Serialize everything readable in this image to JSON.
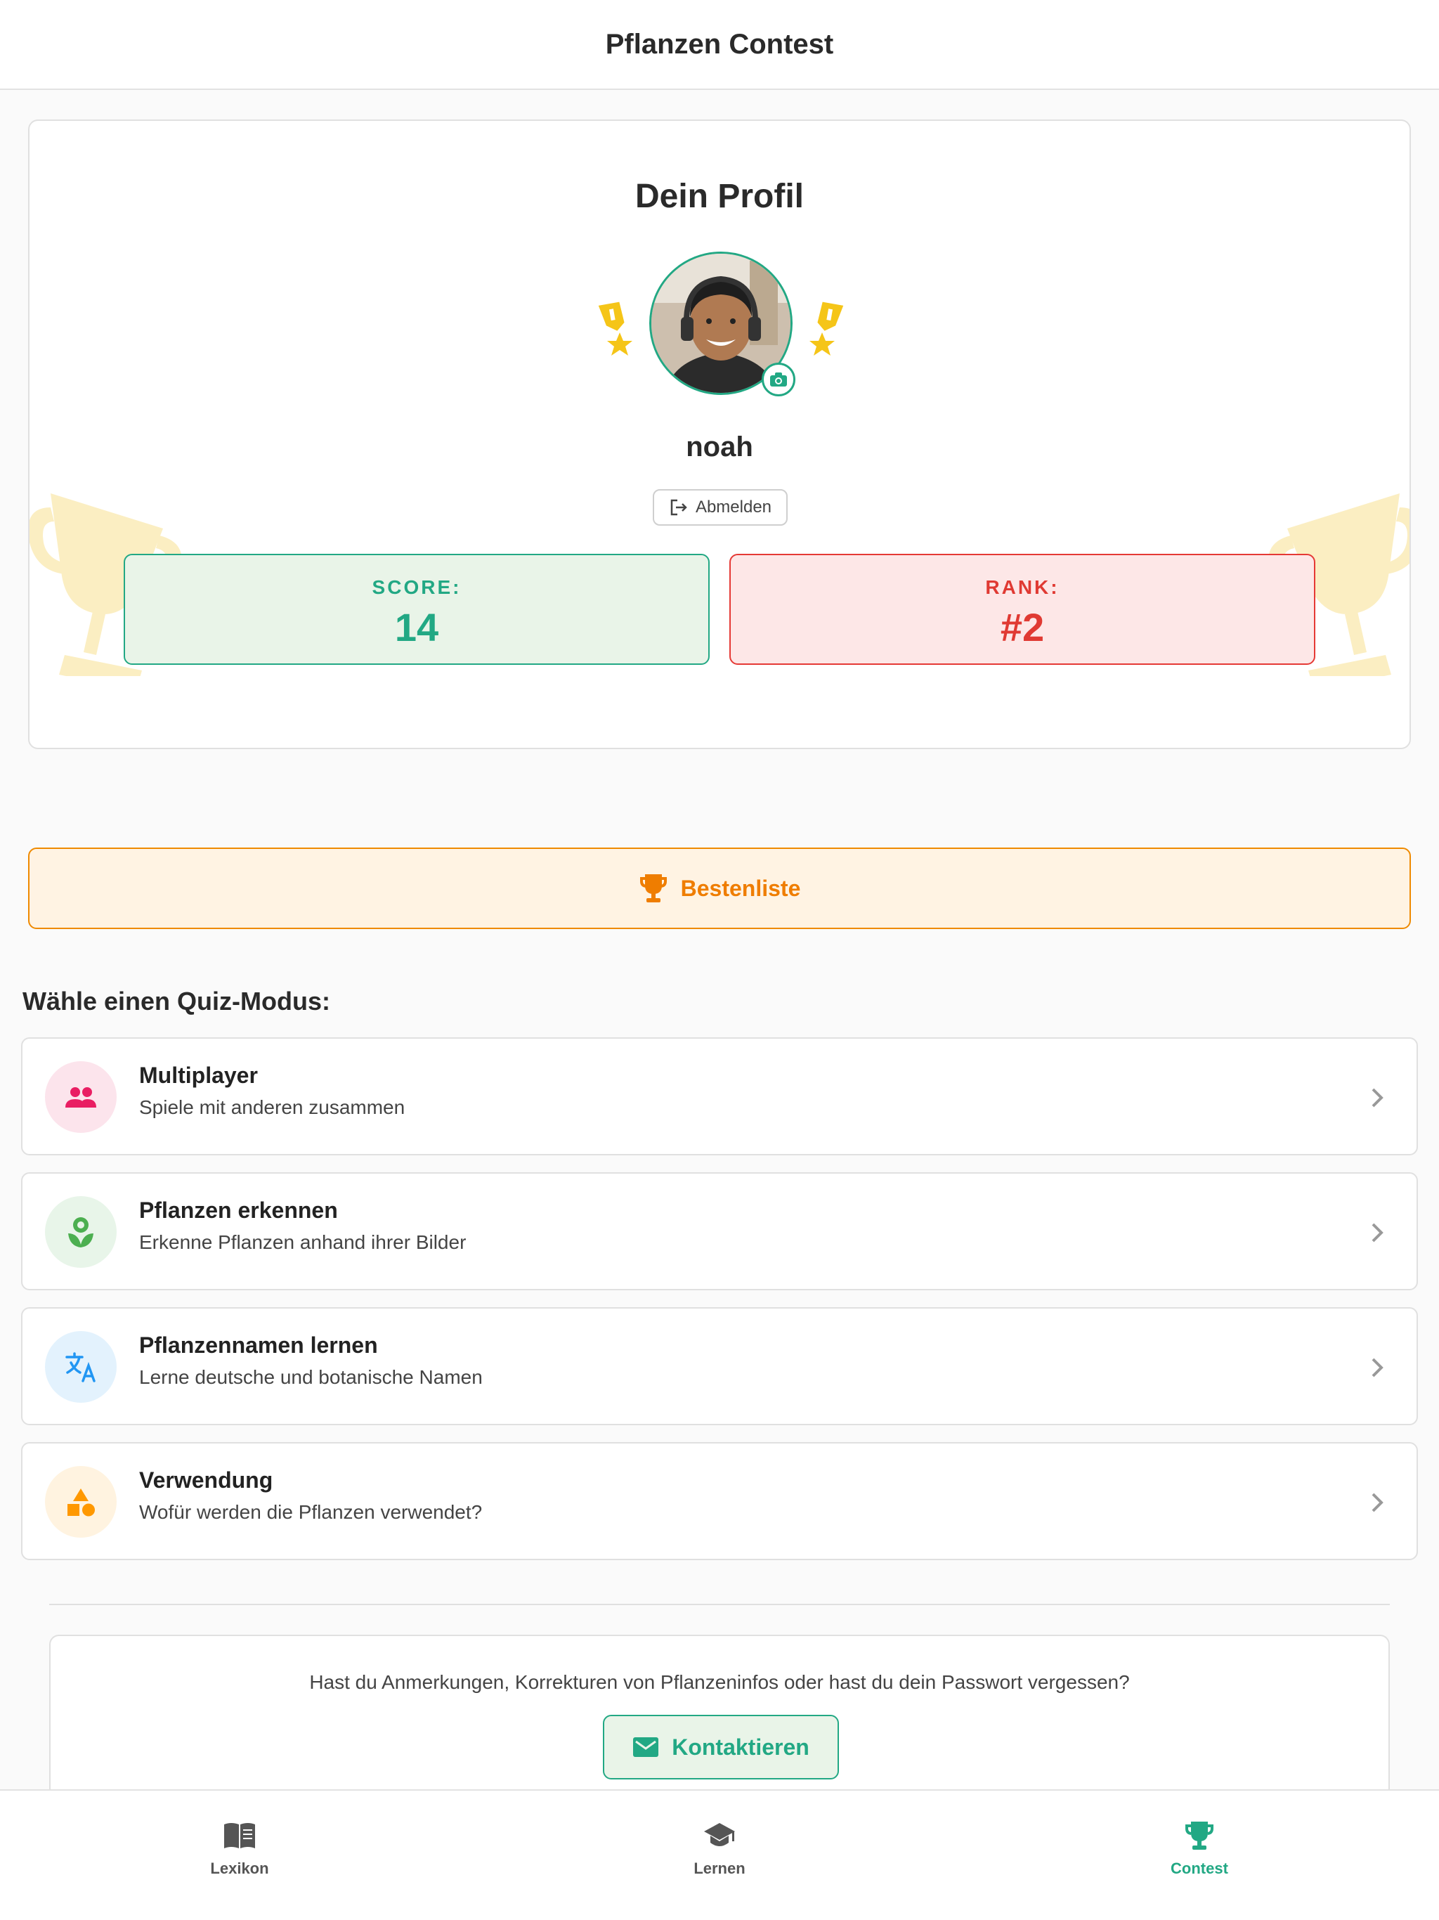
{
  "header": {
    "title": "Pflanzen Contest"
  },
  "profile": {
    "title": "Dein Profil",
    "username": "noah",
    "logout_label": "Abmelden",
    "score_label": "SCORE:",
    "score_value": "14",
    "rank_label": "RANK:",
    "rank_value": "#2"
  },
  "leaderboard": {
    "label": "Bestenliste"
  },
  "quiz": {
    "section_title": "Wähle einen Quiz-Modus:",
    "modes": [
      {
        "title": "Multiplayer",
        "subtitle": "Spiele mit anderen zusammen",
        "icon": "group-icon",
        "color": "#e91e63"
      },
      {
        "title": "Pflanzen erkennen",
        "subtitle": "Erkenne Pflanzen anhand ihrer Bilder",
        "icon": "flower-icon",
        "color": "#4caf50"
      },
      {
        "title": "Pflanzennamen lernen",
        "subtitle": "Lerne deutsche und botanische Namen",
        "icon": "translate-icon",
        "color": "#2196f3"
      },
      {
        "title": "Verwendung",
        "subtitle": "Wofür werden die Pflanzen verwendet?",
        "icon": "shapes-icon",
        "color": "#ff9800"
      }
    ]
  },
  "contact": {
    "text": "Hast du Anmerkungen, Korrekturen von Pflanzeninfos oder hast du dein Passwort vergessen?",
    "button_label": "Kontaktieren"
  },
  "tabbar": {
    "tabs": [
      {
        "label": "Lexikon",
        "icon": "book-icon",
        "active": false
      },
      {
        "label": "Lernen",
        "icon": "graduation-cap-icon",
        "active": false
      },
      {
        "label": "Contest",
        "icon": "trophy-icon",
        "active": true
      }
    ]
  },
  "colors": {
    "accent": "#22a884",
    "rank": "#e03a33",
    "leaderboard": "#ef7d00",
    "medal": "#f5c518"
  }
}
